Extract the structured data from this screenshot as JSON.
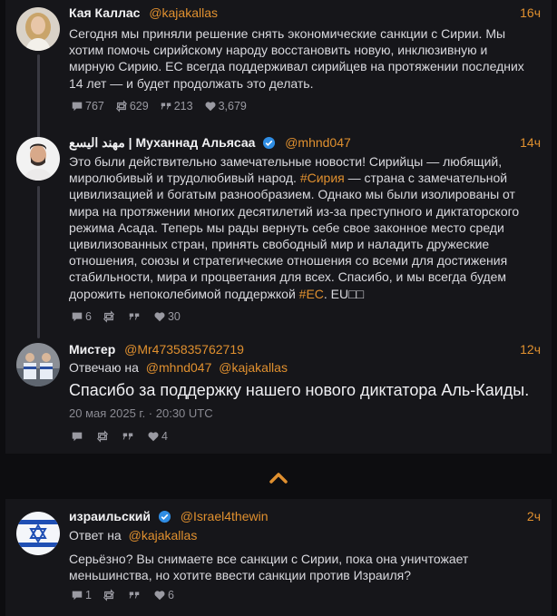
{
  "colors": {
    "accent": "#e0902f",
    "background": "#16161a",
    "verified": "#2f8de4"
  },
  "thread": {
    "posts": [
      {
        "name": "Кая Каллас",
        "handle": "@kajakallas",
        "time": "16ч",
        "text": "Сегодня мы приняли решение снять экономические санкции с Сирии. Мы хотим помочь сирийскому народу восстановить новую, инклюзивную и мирную Сирию. ЕС всегда поддерживал сирийцев на протяжении последних 14 лет — и будет продолжать это делать.",
        "stats": {
          "replies": "767",
          "reposts": "629",
          "quotes": "213",
          "likes": "3,679"
        }
      },
      {
        "name": "مهند اليسع | Муханнад Альясаа",
        "handle": "@mhnd047",
        "time": "14ч",
        "text_a": "Это были действительно замечательные новости! Сирийцы — любящий, миролюбивый и трудолюбивый народ.",
        "hashtag_a": "#Сирия",
        "text_b": "— страна с замечательной цивилизацией и богатым разнообразием. Однако мы были изолированы от мира на протяжении многих десятилетий из-за преступного и диктаторского режима Асада. Теперь мы рады вернуть себе свое законное место среди цивилизованных стран, принять свободный мир и наладить дружеские отношения, союзы и стратегические отношения со всеми для достижения стабильности, мира и процветания для всех. Спасибо, и мы всегда будем дорожить непоколебимой поддержкой",
        "hashtag_b": "#ЕС",
        "text_c": ". EU□□",
        "stats": {
          "replies": "6",
          "reposts": "",
          "quotes": "",
          "likes": "30"
        }
      },
      {
        "name": "Мистер",
        "handle": "@Mr4735835762719",
        "time": "12ч",
        "reply_label": "Отвечаю на",
        "reply_handle_1": "@mhnd047",
        "reply_handle_2": "@kajakallas",
        "text": "Спасибо за поддержку нашего нового диктатора Аль-Каиды.",
        "timestamp": "20 мая 2025 г. · 20:30 UTC",
        "stats": {
          "replies": "",
          "reposts": "",
          "quotes": "",
          "likes": "4"
        }
      }
    ]
  },
  "post2": {
    "name": "израильский",
    "handle": "@Israel4thewin",
    "time": "2ч",
    "reply_label": "Ответ на",
    "reply_handle": "@kajakallas",
    "text": "Серьёзно? Вы снимаете все санкции с Сирии, пока она уничтожает меньшинства, но хотите ввести санкции против Израиля?",
    "stats": {
      "replies": "1",
      "reposts": "",
      "quotes": "",
      "likes": "6"
    }
  }
}
